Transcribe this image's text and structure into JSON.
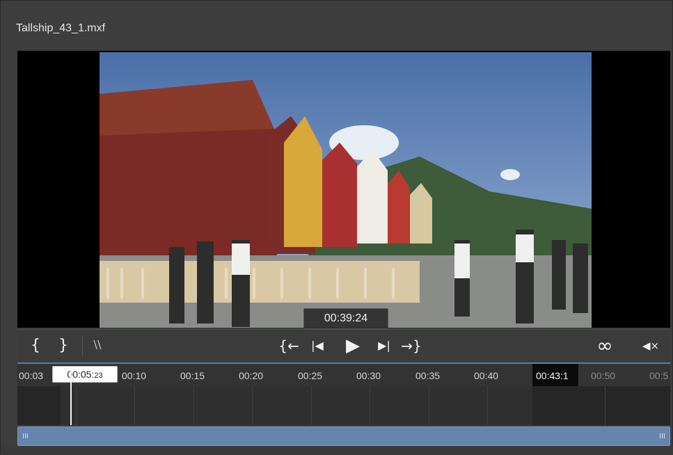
{
  "window": {
    "title": "Tallship_43_1.mxf"
  },
  "viewer": {
    "timecode": "00:39:24"
  },
  "controls": {
    "mark_in": "{",
    "mark_out": "}",
    "clear_marks": "⧵⧵",
    "go_to_in": "{←",
    "step_back": "|◀",
    "play": "▶",
    "step_forward": "▶|",
    "go_to_out": "→}",
    "loop": "∞",
    "mute": "◀×"
  },
  "timeline": {
    "ticks": [
      "00:03",
      "00:10",
      "00:15",
      "00:20",
      "00:25",
      "00:30",
      "00:35",
      "00:40",
      "00:50",
      "00:5"
    ],
    "cursor_label_main": "00:05:",
    "cursor_label_frames": "23",
    "out_point_label": "00:43:1"
  },
  "scrollbar": {
    "left_grip": "III",
    "right_grip": "III"
  }
}
